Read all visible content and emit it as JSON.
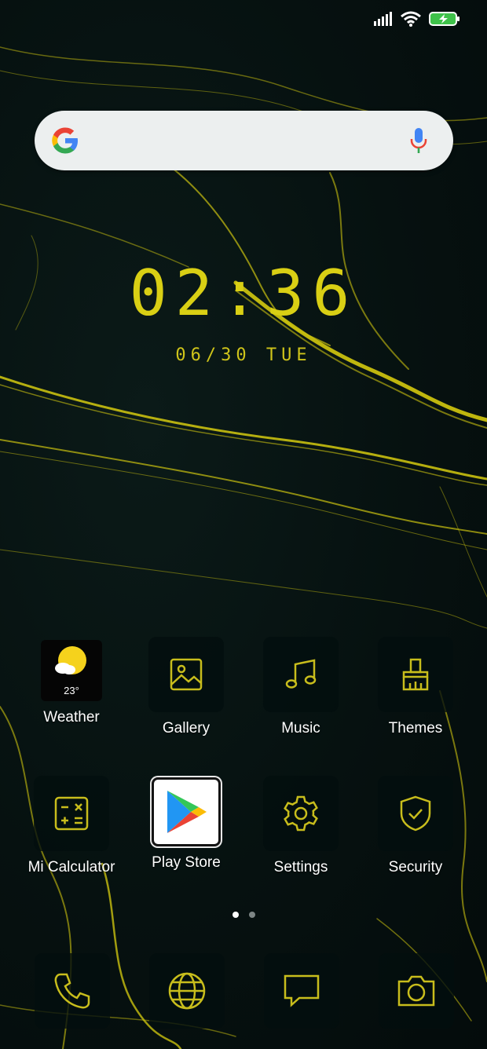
{
  "status_bar": {
    "icons": [
      "signal-icon",
      "wifi-icon",
      "battery-charging-icon"
    ]
  },
  "search": {
    "logo": "google-logo-icon",
    "placeholder": "",
    "mic_icon": "mic-icon"
  },
  "clock": {
    "time": "02:36",
    "date": "06/30 TUE"
  },
  "apps": [
    {
      "label": "Weather",
      "icon": "weather-icon",
      "temp": "23°"
    },
    {
      "label": "Gallery",
      "icon": "gallery-icon"
    },
    {
      "label": "Music",
      "icon": "music-icon"
    },
    {
      "label": "Themes",
      "icon": "brush-icon"
    },
    {
      "label": "Mi Calculator",
      "icon": "calculator-icon"
    },
    {
      "label": "Play Store",
      "icon": "play-store-icon"
    },
    {
      "label": "Settings",
      "icon": "gear-icon"
    },
    {
      "label": "Security",
      "icon": "shield-icon"
    }
  ],
  "pager": {
    "pages": 2,
    "active": 1
  },
  "dock": [
    {
      "icon": "phone-icon"
    },
    {
      "icon": "browser-globe-icon"
    },
    {
      "icon": "messages-icon"
    },
    {
      "icon": "camera-icon"
    }
  ],
  "colors": {
    "accent": "#d9cf14",
    "background": "#061110",
    "icon_stroke": "#c8bd1c"
  }
}
